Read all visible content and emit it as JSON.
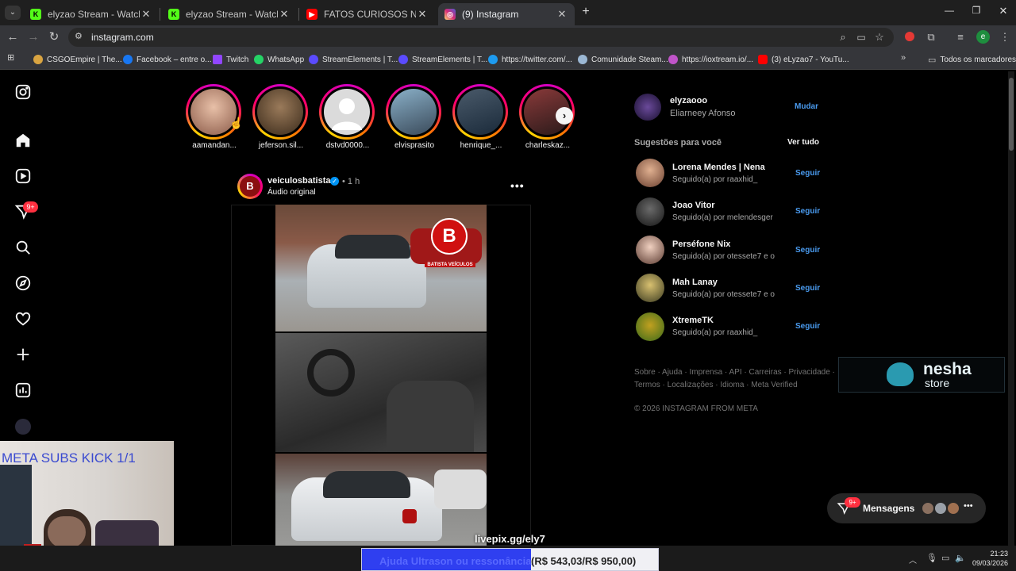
{
  "browser": {
    "tabs": [
      {
        "title": "elyzao Stream - Watch Live on Kick",
        "color": "#53fc18",
        "glyph": "K"
      },
      {
        "title": "elyzao Stream - Watch Live on Kick",
        "color": "#53fc18",
        "glyph": "K"
      },
      {
        "title": "FATOS CURIOSOS NO TRÂNSITO",
        "color": "#ff0000",
        "glyph": "▶"
      },
      {
        "title": "(9) Instagram",
        "color": "#e1306c",
        "glyph": "◎"
      }
    ],
    "url": "instagram.com",
    "bookmarks": [
      {
        "label": "CSGOEmpire | The...",
        "color": "#d9a441"
      },
      {
        "label": "Facebook – entre o...",
        "color": "#1877f2"
      },
      {
        "label": "Twitch",
        "color": "#9146ff"
      },
      {
        "label": "WhatsApp",
        "color": "#25d366"
      },
      {
        "label": "StreamElements | T...",
        "color": "#5b4bff"
      },
      {
        "label": "StreamElements | T...",
        "color": "#5b4bff"
      },
      {
        "label": "https://twitter.com/...",
        "color": "#1d9bf0"
      },
      {
        "label": "Comunidade Steam...",
        "color": "#9bb7d4"
      },
      {
        "label": "https://ioxtream.io/...",
        "color": "#c054c9"
      },
      {
        "label": "(3) eLyzao7 - YouTu...",
        "color": "#ff0000"
      }
    ],
    "all_bookmarks": "Todos os marcadores"
  },
  "nav": {
    "notification_badge": "9+"
  },
  "stories": [
    {
      "name": "aamandan...",
      "color": "#b07a6a"
    },
    {
      "name": "jeferson.sil...",
      "color": "#5a4634"
    },
    {
      "name": "dstvd0000...",
      "color": "#cfcfcf"
    },
    {
      "name": "elvisprasito",
      "color": "#4a6a7a"
    },
    {
      "name": "henrique_...",
      "color": "#2a3a4a"
    },
    {
      "name": "charleskaz...",
      "color": "#6a2a2a"
    }
  ],
  "post": {
    "username": "veiculosbatista",
    "time": "• 1 h",
    "audio": "Áudio original",
    "logo_letter": "B",
    "logo_caption": "BATISTA VEÍCULOS"
  },
  "sidebar": {
    "account": {
      "username": "elyzaooo",
      "fullname": "Eliarneey Afonso",
      "switch": "Mudar"
    },
    "suggestions_title": "Sugestões para você",
    "see_all": "Ver tudo",
    "suggestions": [
      {
        "name": "Lorena Mendes | Nena",
        "sub": "Seguido(a) por raaxhid_",
        "follow": "Seguir",
        "color": "#a07050"
      },
      {
        "name": "Joao Vitor",
        "sub": "Seguido(a) por melendesger",
        "follow": "Seguir",
        "color": "#3a3a3a"
      },
      {
        "name": "Perséfone Nix",
        "sub": "Seguido(a) por otessete7 e o",
        "follow": "Seguir",
        "color": "#c8a090"
      },
      {
        "name": "Mah Lanay",
        "sub": "Seguido(a) por otessete7 e o",
        "follow": "Seguir",
        "color": "#8a7a40"
      },
      {
        "name": "XtremeTK",
        "sub": "Seguido(a) por raaxhid_",
        "follow": "Seguir",
        "color": "#5a8a2a"
      }
    ],
    "footer_links_1": "Sobre · Ajuda · Imprensa · API · Carreiras · Privacidade ·",
    "footer_links_2": "Termos · Localizações · Idioma · Meta Verified",
    "copyright": "© 2026 INSTAGRAM FROM META"
  },
  "overlays": {
    "nesha_big": "nesha",
    "nesha_small": "store",
    "webcam_title": "META SUBS KICK 1/1",
    "livepix": "livepix.gg/ely7",
    "goal_label": "Ajuda Ultrason ou ressonância",
    "goal_value": "(R$ 543,03/R$ 950,00)",
    "goal_progress": 0.57
  },
  "messages": {
    "label": "Mensagens",
    "badge": "9+"
  },
  "taskbar": {
    "time": "21:23",
    "date": "09/03/2026"
  }
}
